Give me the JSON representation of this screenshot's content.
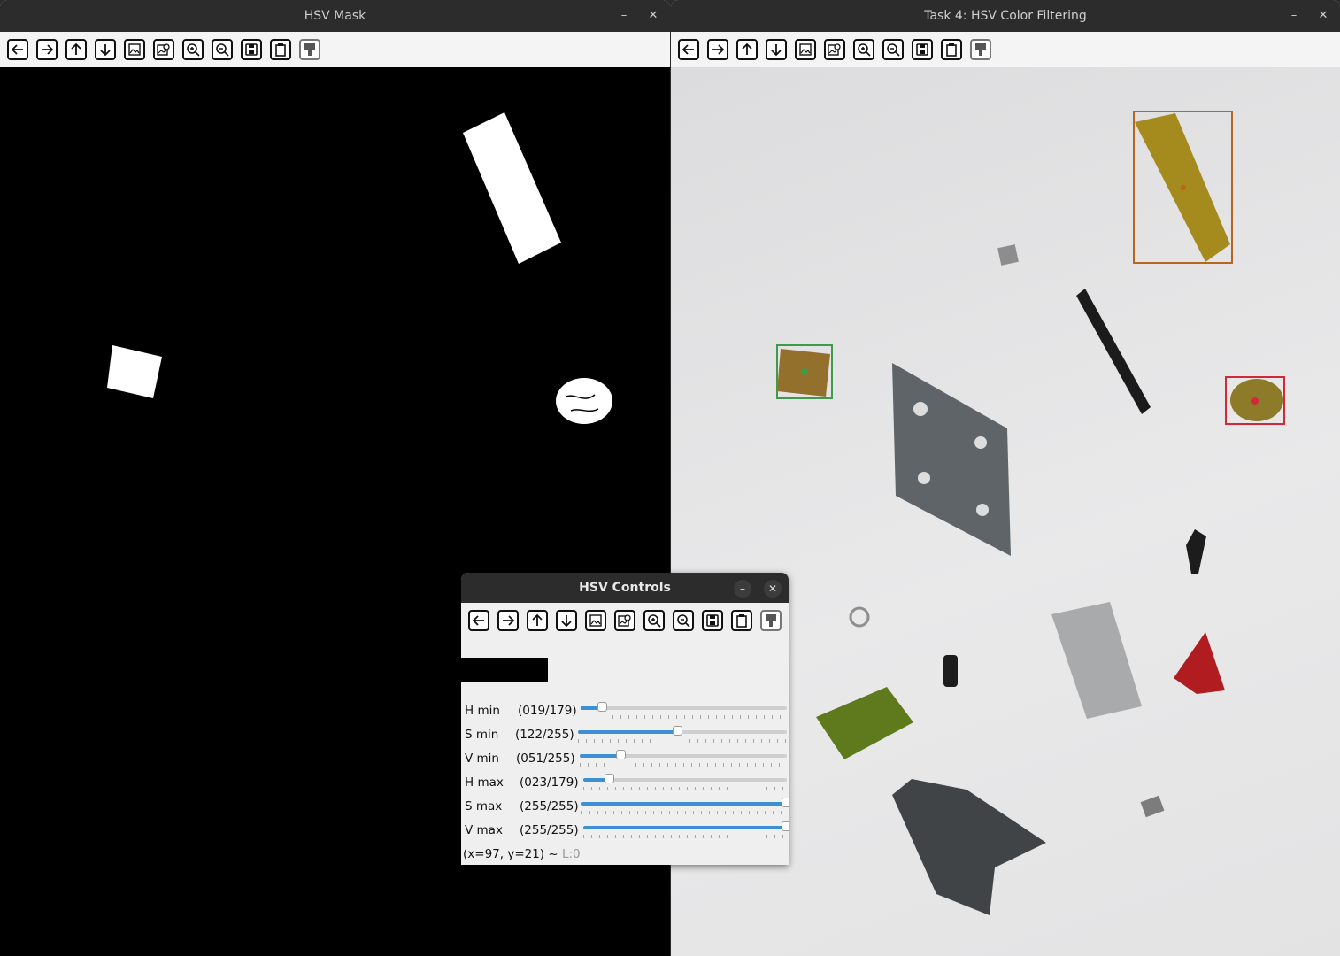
{
  "mask_window": {
    "title": "HSV Mask"
  },
  "result_window": {
    "title": "Task 4: HSV Color Filtering"
  },
  "controls_window": {
    "title": "HSV Controls",
    "sliders": [
      {
        "label": "H min",
        "value_text": "(019/179)",
        "value": 19,
        "max": 179
      },
      {
        "label": "S min",
        "value_text": "(122/255)",
        "value": 122,
        "max": 255
      },
      {
        "label": "V min",
        "value_text": "(051/255)",
        "value": 51,
        "max": 255
      },
      {
        "label": "H max",
        "value_text": "(023/179)",
        "value": 23,
        "max": 179
      },
      {
        "label": "S max",
        "value_text": "(255/255)",
        "value": 255,
        "max": 255
      },
      {
        "label": "V max",
        "value_text": "(255/255)",
        "value": 255,
        "max": 255
      }
    ],
    "status": {
      "coords": "(x=97, y=21) ~ ",
      "level": "L:0"
    }
  },
  "window_buttons": {
    "minimize": "–",
    "close": "✕"
  },
  "toolbar_icons": [
    "arrow-left-icon",
    "arrow-right-icon",
    "arrow-up-icon",
    "arrow-down-icon",
    "image-icon",
    "image-search-icon",
    "zoom-in-icon",
    "zoom-out-icon",
    "save-icon",
    "clipboard-icon",
    "properties-icon"
  ],
  "colors": {
    "slider_fill": "#3d8fd6",
    "titlebar": "#2c2c2c",
    "box_orange": "#b8651e",
    "box_green": "#3f9a4a",
    "box_red": "#d2283c"
  }
}
